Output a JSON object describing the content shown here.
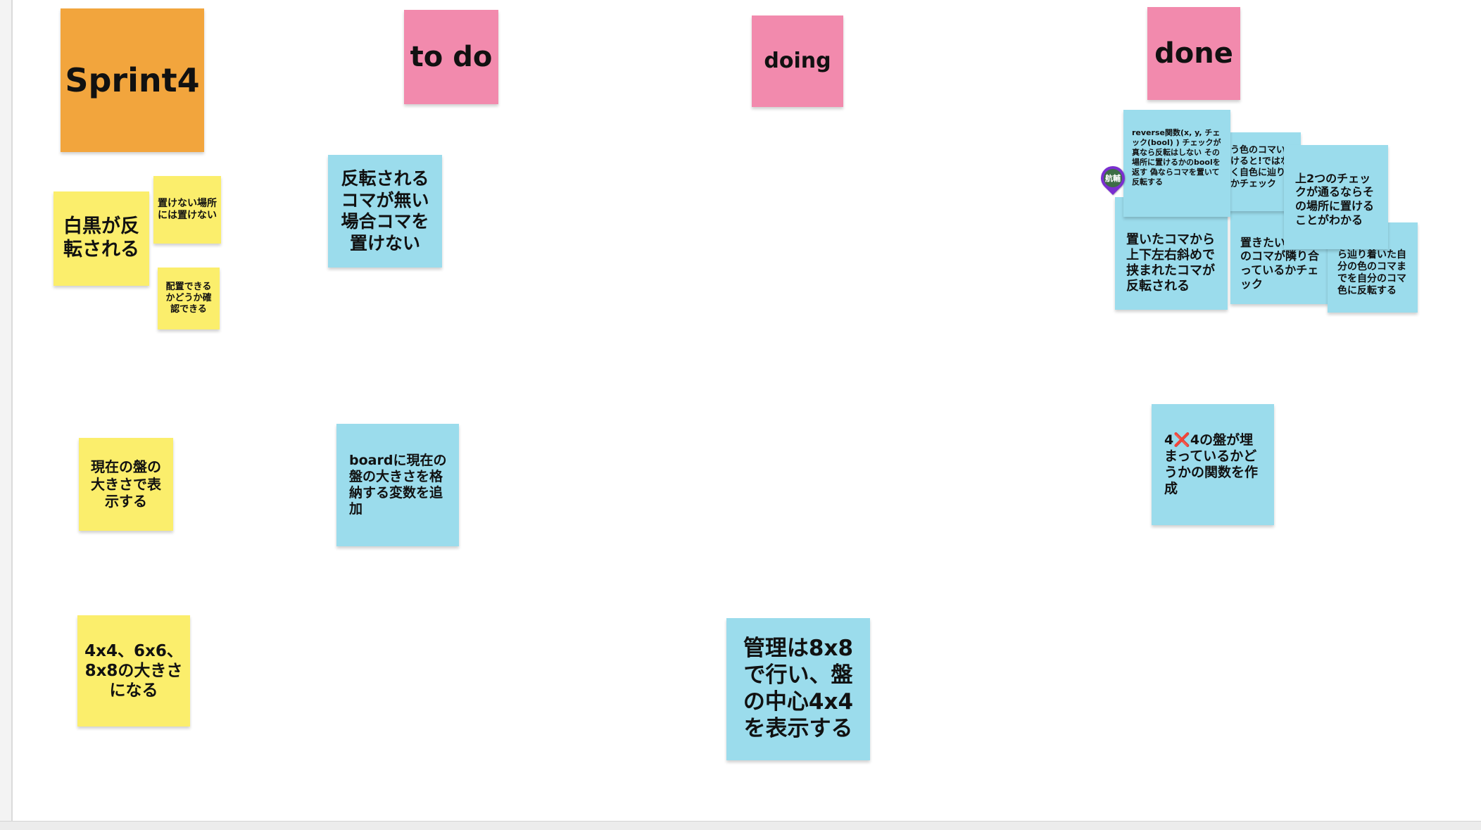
{
  "board": {
    "headers": {
      "sprint": "Sprint4",
      "todo": "to do",
      "doing": "doing",
      "done": "done"
    },
    "backlog": {
      "note_1": "白黒が反転される",
      "note_2": "置けない場所には置けない",
      "note_3": "配置できるかどうか確認できる",
      "note_4": "現在の盤の大きさで表示する",
      "note_5": "4x4、6x6、8x8の大きさになる"
    },
    "todo": {
      "note_1": "反転されるコマが無い場合コマを置けない",
      "note_2": "boardに現在の盤の大きさを格納する変数を追加"
    },
    "doing": {
      "note_1": "管理は8x8で行い、盤の中心4x4を表示する"
    },
    "done": {
      "note_reverse": "reverse関数(x, y, チェック(bool) ) チェックが真なら反転はしない その場所に置けるかのboolを返す 偽ならコマを置いて反転する",
      "note_diff_color": "う色のコマいかけると!ではなく自色に辿り着かチェック",
      "note_two_checks": "上2つのチェックが通るならその場所に置けることがわかる",
      "note_sandwich": "置いたコマから上下左右斜めで挟まれたコマが反転される",
      "note_adjacent": "置きたい違う色のコマが隣り合っているかチェック",
      "note_reach": "ら辿り着いた自分の色のコマまでを自分のコマ色に反転する",
      "note_filled": "4❌4の盤が埋まっているかどうかの関数を作成"
    },
    "marker_label": "航輔"
  }
}
